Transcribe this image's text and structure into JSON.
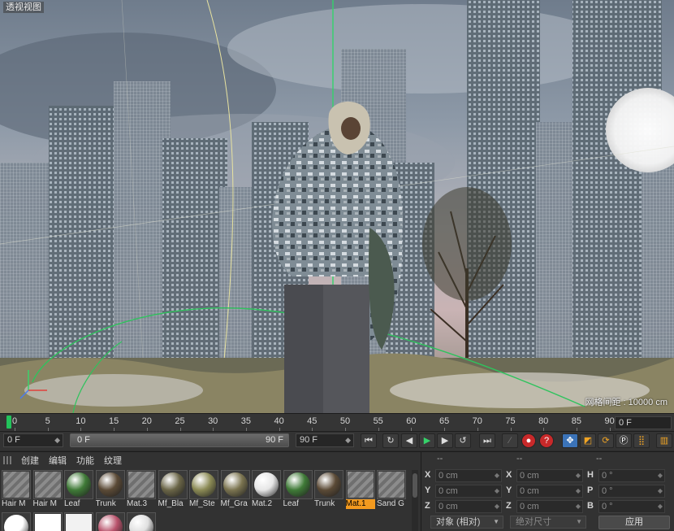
{
  "viewport": {
    "title": "透视视图",
    "grid_spacing": "网格间距 : 10000 cm"
  },
  "timeline": {
    "ticks": [
      "0",
      "5",
      "10",
      "15",
      "20",
      "25",
      "30",
      "35",
      "40",
      "45",
      "50",
      "55",
      "60",
      "65",
      "70",
      "75",
      "80",
      "85",
      "90"
    ],
    "current_frame": "0 F"
  },
  "transport": {
    "start_frame": "0 F",
    "range_start": "0 F",
    "range_end": "90 F",
    "end_frame": "90 F",
    "buttons": [
      "|◀",
      "◀◀",
      "◀|",
      "▶",
      "|▶",
      "▶▶",
      "▶|"
    ]
  },
  "materials": {
    "menu": [
      "创建",
      "编辑",
      "功能",
      "纹理"
    ],
    "row1": [
      {
        "name": "Hair M",
        "kind": "hatch",
        "color": "#8c8c8c"
      },
      {
        "name": "Hair M",
        "kind": "hatch",
        "color": "#8c8c8c"
      },
      {
        "name": "Leaf",
        "kind": "sphere",
        "color": "#3f7a37"
      },
      {
        "name": "Trunk",
        "kind": "sphere",
        "color": "#5b4a36"
      },
      {
        "name": "Mat.3",
        "kind": "hatch",
        "color": "#9a9a9a"
      },
      {
        "name": "Mf_Bla",
        "kind": "sphere",
        "color": "#6a6547"
      },
      {
        "name": "Mf_Ste",
        "kind": "sphere",
        "color": "#8b8a55"
      },
      {
        "name": "Mf_Gra",
        "kind": "sphere",
        "color": "#7b7450"
      },
      {
        "name": "Mat.2",
        "kind": "sphere",
        "color": "#e6e6e6"
      },
      {
        "name": "Leaf",
        "kind": "sphere",
        "color": "#3f7a37"
      },
      {
        "name": "Trunk",
        "kind": "sphere",
        "color": "#5b4a36"
      },
      {
        "name": "Mat.1",
        "kind": "hatch",
        "color": "#8c8c8c",
        "selected": true
      },
      {
        "name": "Sand G",
        "kind": "hatch",
        "color": "#a9a9a9"
      }
    ],
    "row2": [
      {
        "name": "",
        "kind": "sphere",
        "color": "#ffffff"
      },
      {
        "name": "",
        "kind": "flat",
        "color": "#ffffff"
      },
      {
        "name": "",
        "kind": "flat",
        "color": "#f2f2f2"
      },
      {
        "name": "",
        "kind": "sphere",
        "color": "#b8526b"
      },
      {
        "name": "",
        "kind": "sphere",
        "color": "#e0e0e0"
      }
    ]
  },
  "coordinates": {
    "headers": [
      "--",
      "--",
      "--"
    ],
    "rows": [
      {
        "a": "X",
        "av": "0 cm",
        "b": "X",
        "bv": "0 cm",
        "c": "H",
        "cv": "0 °"
      },
      {
        "a": "Y",
        "av": "0 cm",
        "b": "Y",
        "bv": "0 cm",
        "c": "P",
        "cv": "0 °"
      },
      {
        "a": "Z",
        "av": "0 cm",
        "b": "Z",
        "bv": "0 cm",
        "c": "B",
        "cv": "0 °"
      }
    ],
    "mode_dropdown": "对象 (相对)",
    "size_dropdown": "绝对尺寸",
    "apply": "应用"
  },
  "colors": {
    "accent_green": "#22c35b",
    "selection_orange": "#f39a1f",
    "record_red": "#c8292a"
  }
}
